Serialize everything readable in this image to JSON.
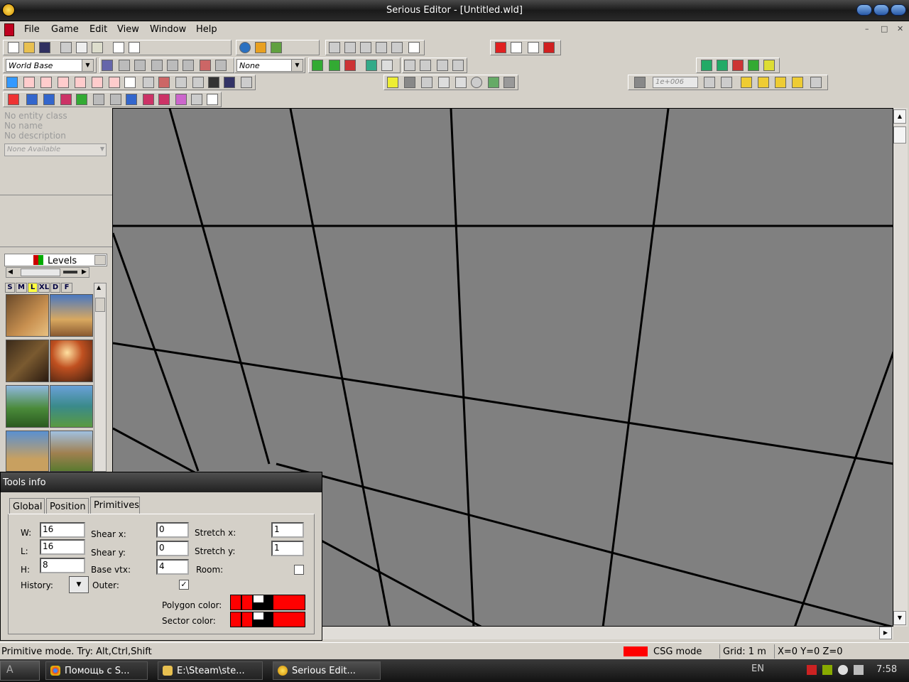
{
  "window": {
    "title": "Serious Editor - [Untitled.wld]"
  },
  "menu": [
    "File",
    "Game",
    "Edit",
    "View",
    "Window",
    "Help"
  ],
  "toolbar": {
    "world_base": "World Base",
    "none_combo": "None",
    "zoom_field": "1e+006"
  },
  "left_panel": {
    "entity_class": "No entity class",
    "entity_name": "No name",
    "entity_desc": "No description",
    "combo": "None Available",
    "levels_label": "Levels",
    "sizes": [
      "S",
      "M",
      "L",
      "XL",
      "D",
      "F"
    ]
  },
  "tools": {
    "title": "Tools info",
    "tabs": [
      "Global",
      "Position",
      "Primitives"
    ],
    "labels": {
      "w": "W:",
      "l": "L:",
      "h": "H:",
      "history": "History:",
      "shear_x": "Shear x:",
      "shear_y": "Shear y:",
      "base_vtx": "Base vtx:",
      "outer": "Outer:",
      "stretch_x": "Stretch x:",
      "stretch_y": "Stretch y:",
      "room": "Room:",
      "polygon_color": "Polygon color:",
      "sector_color": "Sector color:"
    },
    "values": {
      "w": "16",
      "l": "16",
      "h": "8",
      "shear_x": "0",
      "shear_y": "0",
      "base_vtx": "4",
      "stretch_x": "1",
      "stretch_y": "1"
    },
    "outer_checked": "✓"
  },
  "status": {
    "hint": "Primitive mode. Try: Alt,Ctrl,Shift",
    "csg": "CSG mode",
    "grid": "Grid: 1 m",
    "coords": "X=0 Y=0 Z=0"
  },
  "taskbar": {
    "start": "A",
    "tasks": [
      "Помощь с S...",
      "E:\\Steam\\ste...",
      "Serious Edit..."
    ],
    "lang": "EN",
    "clock": "7:58"
  },
  "colors": {
    "accent_red": "#ff0000",
    "viewport": "#808080"
  }
}
